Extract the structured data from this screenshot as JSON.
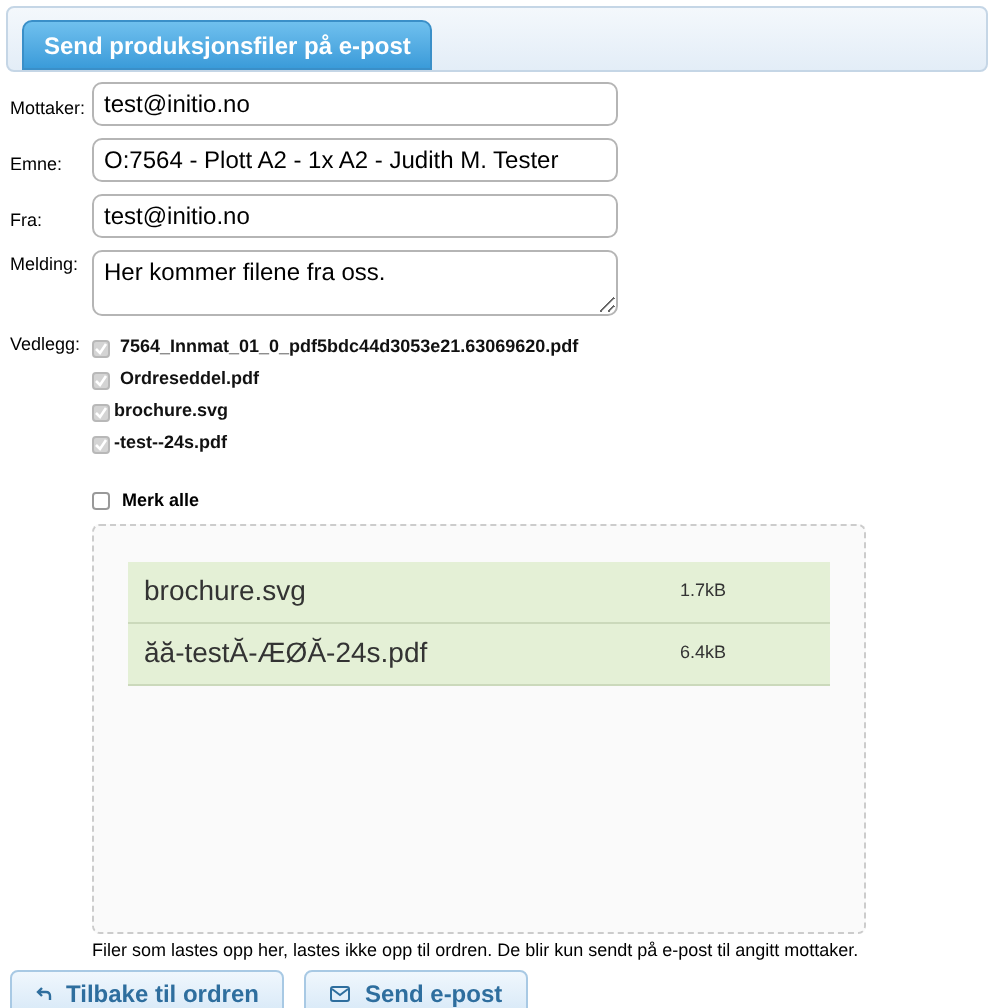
{
  "tabs": [
    {
      "label": "Send produksjonsfiler på e-post",
      "selected": true
    }
  ],
  "fields": [
    {
      "label": "Mottaker:",
      "value": "test@initio.no",
      "kind": "input"
    },
    {
      "label": "Emne:",
      "value": "O:7564 - Plott A2 - 1x A2 - Judith M. Tester",
      "kind": "input"
    },
    {
      "label": "Fra:",
      "value": "test@initio.no",
      "kind": "input"
    },
    {
      "label": "Melding:",
      "value": "Her kommer filene fra oss.",
      "kind": "textarea"
    }
  ],
  "attachments": {
    "label": "Vedlegg:",
    "items": [
      {
        "name": "7564_Innmat_01_0_pdf5bdc44d3053e21.63069620.pdf",
        "checked": true,
        "disabled": true
      },
      {
        "name": "Ordreseddel.pdf",
        "checked": true,
        "disabled": true
      },
      {
        "name": "brochure.svg",
        "checked": true,
        "disabled": true
      },
      {
        "name": "-test--24s.pdf",
        "checked": true,
        "disabled": true
      }
    ]
  },
  "select_all": {
    "label": "Merk alle",
    "checked": false
  },
  "uploads": [
    {
      "name": "brochure.svg",
      "size": "1.7kB"
    },
    {
      "name": "ăă-testĂ-ÆØĂ-24s.pdf",
      "size": "6.4kB"
    }
  ],
  "note": "Filer som lastes opp her, lastes ikke opp til ordren. De blir kun sendt på e-post til angitt mottaker.",
  "buttons": [
    {
      "label": "Tilbake til ordren",
      "kind": "back"
    },
    {
      "label": "Send e-post",
      "kind": "mail"
    }
  ]
}
